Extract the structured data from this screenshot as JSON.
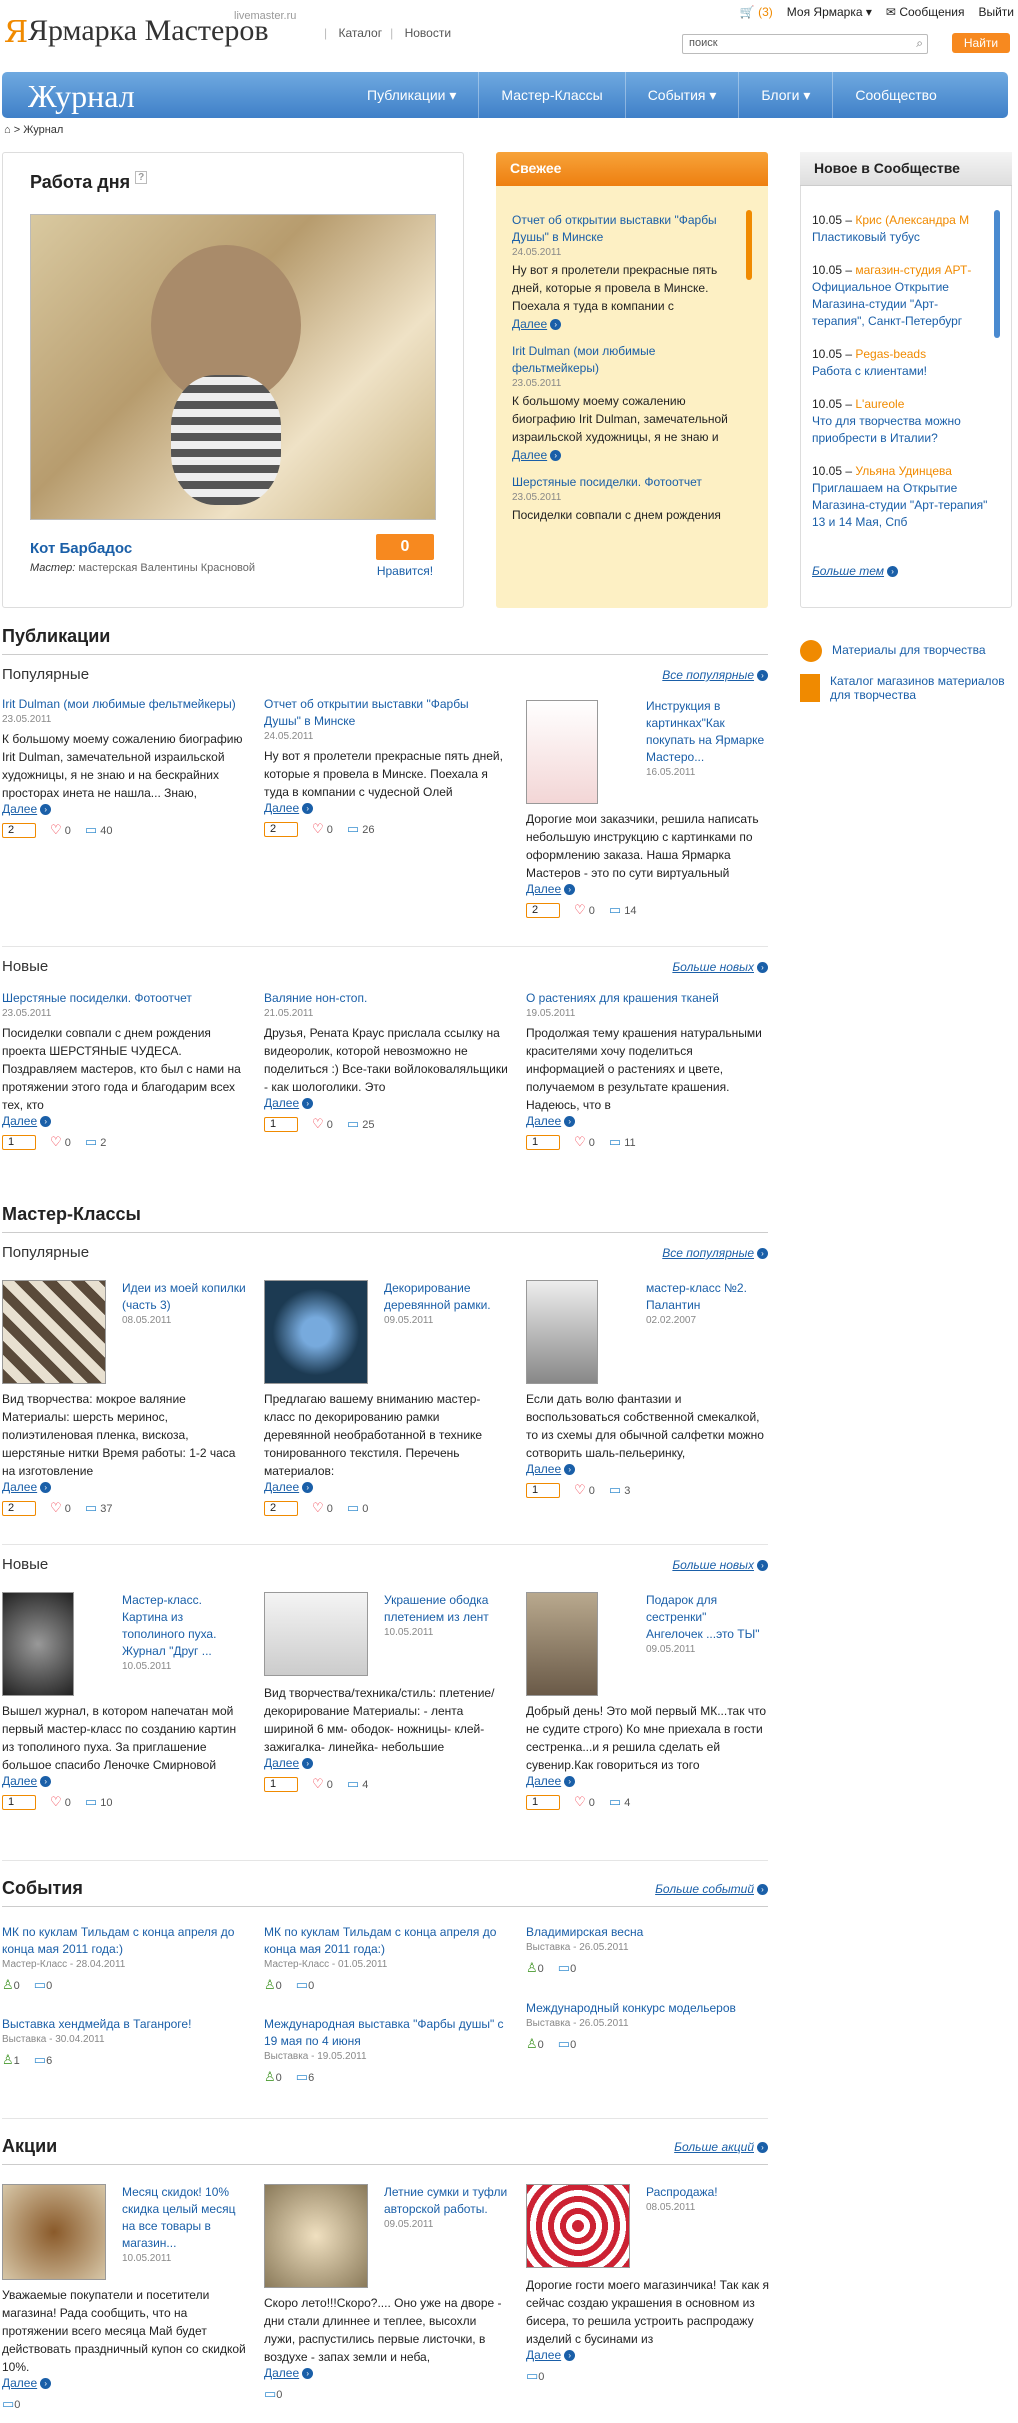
{
  "header": {
    "logo_mark": "Я",
    "logo": "Ярмарка Мастеров",
    "domain": "livemaster.ru",
    "links": [
      "Каталог",
      "Новости"
    ],
    "cart_count": "(3)",
    "my_fair": "Моя Ярмарка",
    "messages": "Сообщения",
    "logout": "Выйти",
    "search_placeholder": "поиск",
    "search_button": "Найти"
  },
  "nav": {
    "title": "Журнал",
    "items": [
      "Публикации",
      "Мастер-Классы",
      "События",
      "Блоги",
      "Сообщество"
    ]
  },
  "breadcrumb": "> Журнал",
  "work_of_day": {
    "title": "Работа дня",
    "name": "Кот Барбадос",
    "master_label": "Мастер:",
    "master": "мастерская Валентины Красновой",
    "likes": "0",
    "likes_label": "Нравится!"
  },
  "fresh": {
    "title": "Свежее",
    "items": [
      {
        "title": "Отчет об открытии выставки \"Фарбы Душы\" в Минске",
        "date": "24.05.2011",
        "text": "Ну вот я пролетели прекрасные пять дней, которые я провела в Минске. Поехала я туда в компании с",
        "more": "Далее"
      },
      {
        "title": "Irit Dulman (мои любимые фельтмейкеры)",
        "date": "23.05.2011",
        "text": "К большому моему сожалению биографию Irit Dulman, замечательной израильской художницы, я не знаю и",
        "more": "Далее"
      },
      {
        "title": "Шерстяные посиделки. Фотоотчет",
        "date": "23.05.2011",
        "text": "Посиделки совпали с днем рождения",
        "more": ""
      }
    ]
  },
  "community": {
    "title": "Новое в Сообществе",
    "items": [
      {
        "date": "10.05",
        "name": "Крис (Александра М",
        "text": "Пластиковый тубус"
      },
      {
        "date": "10.05",
        "name": "магазин-студия АРТ-",
        "text": "Официальное Открытие Магазина-студии \"Арт-терапия\", Санкт-Петербург"
      },
      {
        "date": "10.05",
        "name": "Pegas-beads",
        "text": "Работа с клиентами!"
      },
      {
        "date": "10.05",
        "name": "L'aureole",
        "text": "Что для творчества можно приобрести в Италии?"
      },
      {
        "date": "10.05",
        "name": "Ульяна Удинцева",
        "text": "Приглашаем на Открытие Магазина-студии \"Арт-терапия\" 13 и 14 Мая, Спб"
      }
    ],
    "more": "Больше тем"
  },
  "side_links": [
    "Материалы для творчества",
    "Каталог магазинов материалов для творчества"
  ],
  "publications": {
    "title": "Публикации",
    "popular": "Популярные",
    "popular_more": "Все популярные",
    "new": "Новые",
    "new_more": "Больше новых",
    "popular_items": [
      {
        "title": "Irit Dulman (мои любимые фельтмейкеры)",
        "date": "23.05.2011",
        "text": "К большому моему сожалению биографию Irit Dulman, замечательной израильской художницы, я не знаю и на бескрайних просторах инета не нашла... Знаю,",
        "more": "Далее",
        "likes": "2",
        "hearts": "0",
        "comments": "40"
      },
      {
        "title": "Отчет об открытии выставки \"Фарбы Душы\" в Минске",
        "date": "24.05.2011",
        "text": "Ну вот я пролетели прекрасные пять дней, которые я провела в Минске. Поехала я туда в компании с чудесной Олей",
        "more": "Далее",
        "likes": "2",
        "hearts": "0",
        "comments": "26"
      },
      {
        "title": "Инструкция в картинках\"Как покупать на Ярмарке Мастеро...",
        "date": "16.05.2011",
        "text": "Дорогие мои заказчики, решила написать небольшую инструкцию с картинками по оформлению заказа. Наша Ярмарка Мастеров - это по сути виртуальный",
        "more": "Далее",
        "likes": "2",
        "hearts": "0",
        "comments": "14"
      }
    ],
    "new_items": [
      {
        "title": "Шерстяные посиделки. Фотоотчет",
        "date": "23.05.2011",
        "text": "Посиделки совпали с днем рождения проекта ШЕРСТЯНЫЕ ЧУДЕСА. Поздравляем мастеров, кто был с нами на протяжении этого года и благодарим всех тех, кто",
        "more": "Далее",
        "likes": "1",
        "hearts": "0",
        "comments": "2"
      },
      {
        "title": "Валяние нон-стоп.",
        "date": "21.05.2011",
        "text": "Друзья, Рената Краус   прислала ссылку на видеоролик,  которой невозможно не поделиться :) Все-таки войлоковаляльщики - как шологолики. Это",
        "more": "Далее",
        "likes": "1",
        "hearts": "0",
        "comments": "25"
      },
      {
        "title": "О растениях для крашения тканей",
        "date": "19.05.2011",
        "text": "Продолжая тему крашения натуральными красителями хочу поделиться информацией о растениях и цвете, получаемом в результате крашения. Надеюсь, что в",
        "more": "Далее",
        "likes": "1",
        "hearts": "0",
        "comments": "11"
      }
    ]
  },
  "masterclasses": {
    "title": "Мастер-Классы",
    "popular": "Популярные",
    "popular_more": "Все популярные",
    "new": "Новые",
    "new_more": "Больше новых",
    "popular_items": [
      {
        "title": "Идеи из моей копилки (часть 3)",
        "date": "08.05.2011",
        "text": "Вид творчества: мокрое валяние Материалы:  шерсть меринос, полиэтиленовая пленка, вискоза, шерстяные нитки Время работы:  1-2 часа на изготовление",
        "more": "Далее",
        "likes": "2",
        "hearts": "0",
        "comments": "37"
      },
      {
        "title": "Декорирование деревянной рамки.",
        "date": "09.05.2011",
        "text": "Предлагаю вашему вниманию мастер-класс по декорированию рамки деревянной необработанной  в технике тонированного текстиля. Перечень материалов:",
        "more": "Далее",
        "likes": "2",
        "hearts": "0",
        "comments": "0"
      },
      {
        "title": "мастер-класс №2. Палантин",
        "date": "02.02.2007",
        "text": "Если дать волю фантазии и воспользоваться собственной смекалкой, то из схемы для обычной салфетки можно сотворить шаль-пельеринку,",
        "more": "Далее",
        "likes": "1",
        "hearts": "0",
        "comments": "3"
      }
    ],
    "new_items": [
      {
        "title": "Мастер-класс. Картина из тополиного пуха. Журнал \"Друг ...",
        "date": "10.05.2011",
        "text": "Вышел журнал, в котором напечатан мой первый мастер-класс по созданию картин из тополиного пуха. За приглашение большое спасибо Леночке Смирновой",
        "more": "Далее",
        "likes": "1",
        "hearts": "0",
        "comments": "10"
      },
      {
        "title": "Украшение ободка плетением из лент",
        "date": "10.05.2011",
        "text": "Вид творчества/техника/стиль: плетение/декорирование Материалы: - лента шириной 6 мм- ободок- ножницы- клей-зажигалка- линейка- небольшие",
        "more": "Далее",
        "likes": "1",
        "hearts": "0",
        "comments": "4"
      },
      {
        "title": "Подарок для сестренки\" Ангелочек ...это ТЫ\"",
        "date": "09.05.2011",
        "text": "Добрый день! Это мой первый МК...так что не судите строго) Ко мне приехала в гости сестренка...и я решила сделать ей сувенир.Как говориться из того",
        "more": "Далее",
        "likes": "1",
        "hearts": "0",
        "comments": "4"
      }
    ]
  },
  "events": {
    "title": "События",
    "more": "Больше событий",
    "items": [
      {
        "title": "МК по куклам Тильдам с конца апреля до конца мая 2011 года:)",
        "meta": "Мастер-Класс - 28.04.2011",
        "users": "0",
        "comments": "0"
      },
      {
        "title": "МК по куклам Тильдам с конца апреля до конца мая 2011 года:)",
        "meta": "Мастер-Класс - 01.05.2011",
        "users": "0",
        "comments": "0"
      },
      {
        "title": "Владимирская весна",
        "meta": "Выставка - 26.05.2011",
        "users": "0",
        "comments": "0"
      },
      {
        "title": "Выставка хендмейда в Таганроге!",
        "meta": "Выставка - 30.04.2011",
        "users": "1",
        "comments": "6"
      },
      {
        "title": "Международная выставка \"Фарбы душы\" с 19 мая по 4 июня",
        "meta": "Выставка - 19.05.2011",
        "users": "0",
        "comments": "6"
      },
      {
        "title": "Международный конкурс модельеров",
        "meta": "Выставка - 26.05.2011",
        "users": "0",
        "comments": "0"
      }
    ]
  },
  "actions": {
    "title": "Акции",
    "more": "Больше акций",
    "items": [
      {
        "title": "Месяц скидок! 10% скидка целый месяц на все товары в магазин...",
        "date": "10.05.2011",
        "text": "Уважаемые покупатели и посетители магазина!  Рада сообщить, что на протяжении всего месяца Май будет действовать праздничный купон со скидкой 10%.",
        "more": "Далее",
        "comments": "0"
      },
      {
        "title": "Летние сумки и туфли авторской работы.",
        "date": "09.05.2011",
        "text": "Скоро лето!!!Скоро?.... Оно уже на дворе - дни стали длиннее и теплее, высохли лужи, распустились первые листочки, в воздухе - запах земли и неба,",
        "more": "Далее",
        "comments": "0"
      },
      {
        "title": "Распродажа!",
        "date": "08.05.2011",
        "text": "Дорогие гости моего магазинчика! Так как я сейчас создаю украшения в основном из бисера, то решила устроить распродажу изделий с бусинами из",
        "more": "Далее",
        "comments": "0"
      }
    ]
  },
  "colors": {
    "accent": "#f7891f",
    "link": "#1a5fa8",
    "nav": "#4a8ad0",
    "fresh_bg": "#fdf0c4"
  }
}
